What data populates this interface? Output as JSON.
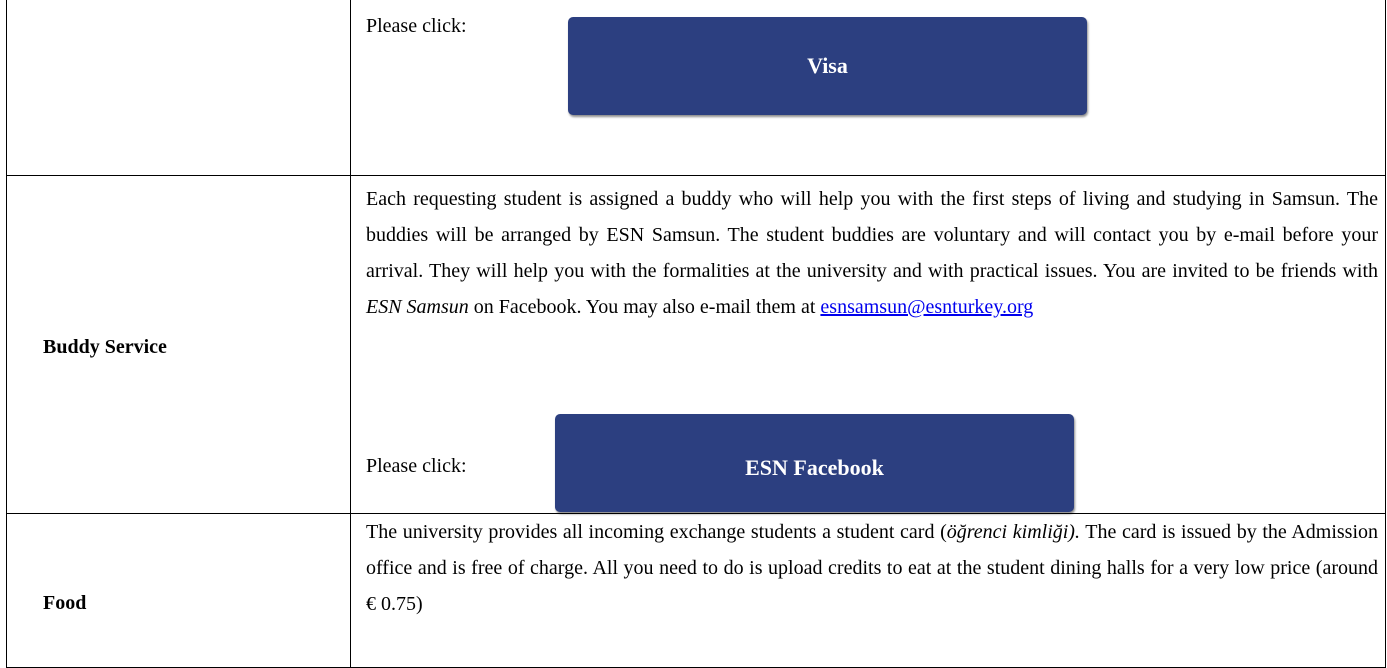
{
  "rows": {
    "visa": {
      "please_click": "Please click:",
      "button_label": "Visa"
    },
    "buddy": {
      "label": "Buddy Service",
      "paragraph_part1": "Each requesting student is assigned a buddy who will help you with the first steps of living and studying in Samsun. The buddies will be arranged by ESN Samsun. The student buddies are voluntary and will contact you by e-mail before your arrival. They will help you with the formalities at the university and with practical issues. You are invited to be friends with ",
      "paragraph_italic": "ESN Samsun",
      "paragraph_part2": " on Facebook. You may also e-mail them at ",
      "email": "esnsamsun@esnturkey.org",
      "please_click": "Please click:",
      "button_label": "ESN Facebook"
    },
    "food": {
      "label": "Food",
      "paragraph_part1": "The university provides all incoming exchange students a student card (",
      "paragraph_italic": "öğrenci kimliği).",
      "paragraph_part2": " The card is issued by the Admission office and is free of charge. All you need to do is upload credits to eat at the student dining halls for a very low price (around € 0.75)"
    }
  },
  "colors": {
    "button_bg": "#2c3f80",
    "button_text": "#ffffff",
    "link": "#0000ee"
  }
}
